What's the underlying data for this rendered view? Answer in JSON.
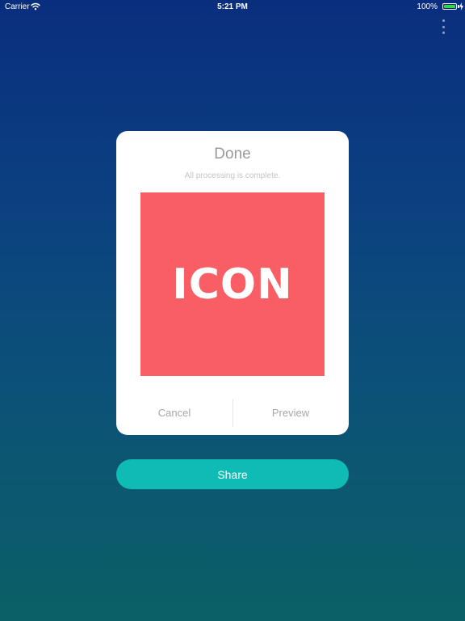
{
  "status_bar": {
    "carrier": "Carrier",
    "time": "5:21 PM",
    "battery_percent": "100%",
    "battery_level": 1.0,
    "battery_color": "#35d158"
  },
  "dialog": {
    "title": "Done",
    "subtitle": "All processing is complete.",
    "icon_label": "ICON",
    "icon_background": "#f85e63",
    "cancel_label": "Cancel",
    "preview_label": "Preview"
  },
  "share_button": {
    "label": "Share",
    "color": "#0fbcb5"
  },
  "icons": {
    "wifi": "wifi-icon",
    "battery": "battery-icon",
    "charging": "charging-bolt-icon",
    "more": "more-vertical-icon"
  }
}
